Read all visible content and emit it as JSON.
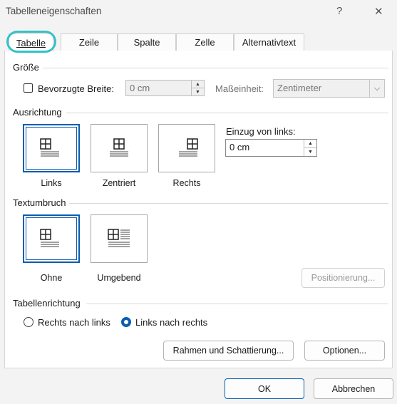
{
  "window": {
    "title": "Tabelleneigenschaften",
    "help_glyph": "?",
    "close_glyph": "✕"
  },
  "tabs": [
    {
      "label": "Tabelle",
      "active": true
    },
    {
      "label": "Zeile"
    },
    {
      "label": "Spalte"
    },
    {
      "label": "Zelle"
    },
    {
      "label": "Alternativtext"
    }
  ],
  "size": {
    "section": "Größe",
    "preferred_width_label": "Bevorzugte Breite:",
    "preferred_width_value": "0 cm",
    "unit_label": "Maßeinheit:",
    "unit_value": "Zentimeter"
  },
  "alignment": {
    "section": "Ausrichtung",
    "options": [
      {
        "label": "Links",
        "selected": true
      },
      {
        "label": "Zentriert"
      },
      {
        "label": "Rechts"
      }
    ],
    "indent_label": "Einzug von links:",
    "indent_value": "0 cm"
  },
  "wrapping": {
    "section": "Textumbruch",
    "options": [
      {
        "label": "Ohne",
        "selected": true
      },
      {
        "label": "Umgebend"
      }
    ],
    "positioning_button": "Positionierung..."
  },
  "direction": {
    "section": "Tabellenrichtung",
    "options": [
      {
        "label": "Rechts nach links",
        "selected": false
      },
      {
        "label": "Links nach rechts",
        "selected": true
      }
    ]
  },
  "buttons": {
    "borders": "Rahmen und Schattierung...",
    "options": "Optionen...",
    "ok": "OK",
    "cancel": "Abbrechen"
  },
  "colors": {
    "accent": "#0b5cad",
    "tab_highlight": "#33c2c7"
  }
}
